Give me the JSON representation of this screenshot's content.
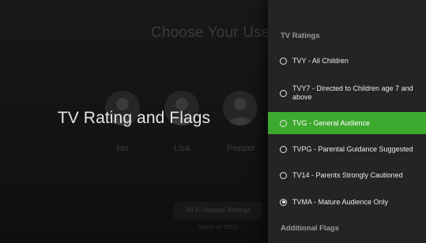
{
  "background": {
    "title": "Choose Your User",
    "users": [
      {
        "name": "Ian"
      },
      {
        "name": "Lisa"
      },
      {
        "name": "Pepper"
      }
    ],
    "wifi_button": "Wi-Fi Network Settings",
    "device_id": "Device Id: 30521"
  },
  "overlay": {
    "title": "TV Rating and Flags"
  },
  "panel": {
    "section_tv_ratings": "TV Ratings",
    "options": [
      {
        "label": "TVY - All Children",
        "selected": false,
        "checked": false
      },
      {
        "label": "TVY7 - Directed to Children age 7 and above",
        "selected": false,
        "checked": false
      },
      {
        "label": "TVG - General Audience",
        "selected": true,
        "checked": false
      },
      {
        "label": "TVPG - Parental Guidance Suggested",
        "selected": false,
        "checked": false
      },
      {
        "label": "TV14 - Parents Strongly Cautioned",
        "selected": false,
        "checked": false
      },
      {
        "label": "TVMA - Mature Audience Only",
        "selected": false,
        "checked": true
      }
    ],
    "section_additional_flags": "Additional Flags"
  },
  "colors": {
    "accent_green": "#3ea92f",
    "panel_bg": "#242424",
    "page_bg": "#0d0d0d"
  }
}
